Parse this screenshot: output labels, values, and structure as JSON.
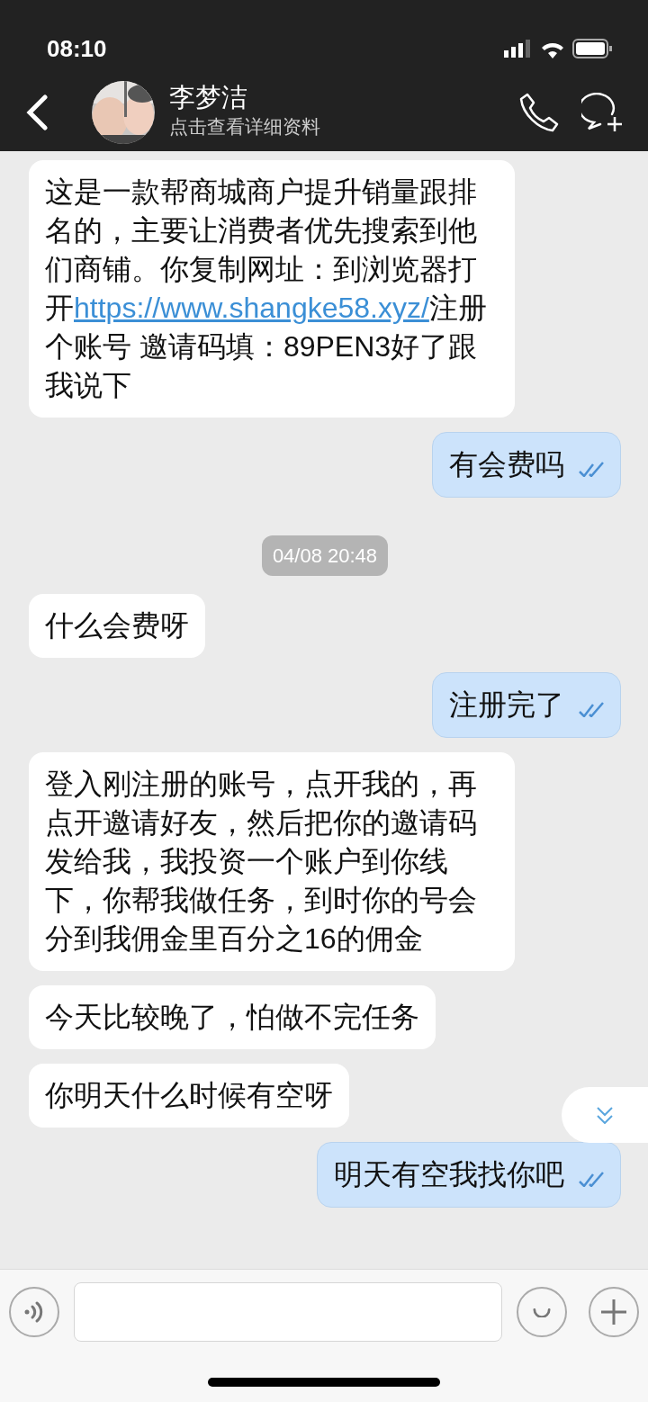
{
  "status_bar": {
    "time": "08:10"
  },
  "header": {
    "name": "李梦洁",
    "subtitle": "点击查看详细资料"
  },
  "messages": [
    {
      "kind": "incoming",
      "text": "这是一款帮商城商户提升销量跟排名的，主要让消费者优先搜索到他们商铺。你复制网址：到浏览器打开",
      "link": "https://www.shangke58.xyz/",
      "text_after": "注册个账号 邀请码填：89PEN3好了跟我说下"
    },
    {
      "kind": "outgoing",
      "text": "有会费吗",
      "read": true
    },
    {
      "kind": "time",
      "text": "04/08 20:48"
    },
    {
      "kind": "incoming",
      "text": "什么会费呀"
    },
    {
      "kind": "outgoing",
      "text": "注册完了",
      "read": true
    },
    {
      "kind": "incoming",
      "text": "登入刚注册的账号，点开我的，再点开邀请好友，然后把你的邀请码发给我，我投资一个账户到你线下，你帮我做任务，到时你的号会分到我佣金里百分之16的佣金"
    },
    {
      "kind": "incoming",
      "text": "今天比较晚了，怕做不完任务"
    },
    {
      "kind": "incoming",
      "text": "你明天什么时候有空呀"
    },
    {
      "kind": "outgoing",
      "text": "明天有空我找你吧",
      "read": true
    }
  ]
}
